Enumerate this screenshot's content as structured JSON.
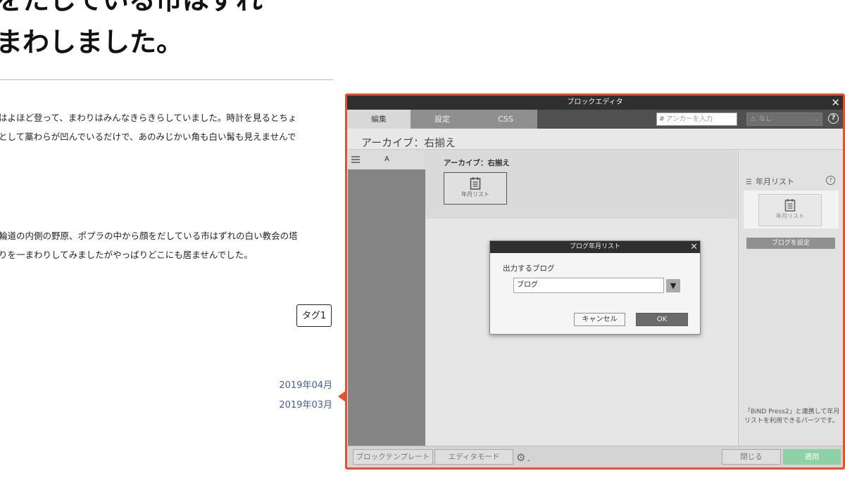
{
  "article": {
    "heading_lines": [
      "をたしている市はずれ",
      "まわしました。"
    ],
    "paragraph1": [
      "はよほど登って、まわりはみんなきらきらしていました。時計を見るとちょ",
      "として藁わらが凹んでいるだけで、あのみじかい角も白い髯も見えませんで"
    ],
    "paragraph2": [
      "輪道の内側の野原、ポプラの中から顔をだしている市はずれの白い教会の塔",
      "りを一まわりしてみましたがやっぱりどこにも居ませんでした。"
    ],
    "tag": "タグ1",
    "archive_links": [
      "2019年04月",
      "2019年03月"
    ]
  },
  "editor": {
    "title": "ブロックエディタ",
    "tabs": [
      "編集",
      "設定",
      "CSS"
    ],
    "anchor_placeholder": "アンカーを入力",
    "condition_select": "なし",
    "block_title": "アーカイブ：右揃え",
    "column_label": "A",
    "canvas_label": "アーカイブ：右揃え",
    "block_icon_label": "年月リスト",
    "right_panel": {
      "title": "年月リスト",
      "thumb_label": "年月リスト",
      "button": "ブログを設定",
      "description": "「BiND Press2」と連携して年月リストを利用できるパーツです。"
    },
    "footer": {
      "template_button": "ブロックテンプレート",
      "mode_button": "エディタモード",
      "close_button": "閉じる",
      "apply_button": "適用"
    }
  },
  "dialog": {
    "title": "ブログ年月リスト",
    "label": "出力するブログ",
    "selected_blog": "ブログ",
    "cancel": "キャンセル",
    "ok": "OK"
  },
  "colors": {
    "accent_border": "#e4512e",
    "apply_button": "#8fd1a7",
    "link": "#4a5e96"
  }
}
